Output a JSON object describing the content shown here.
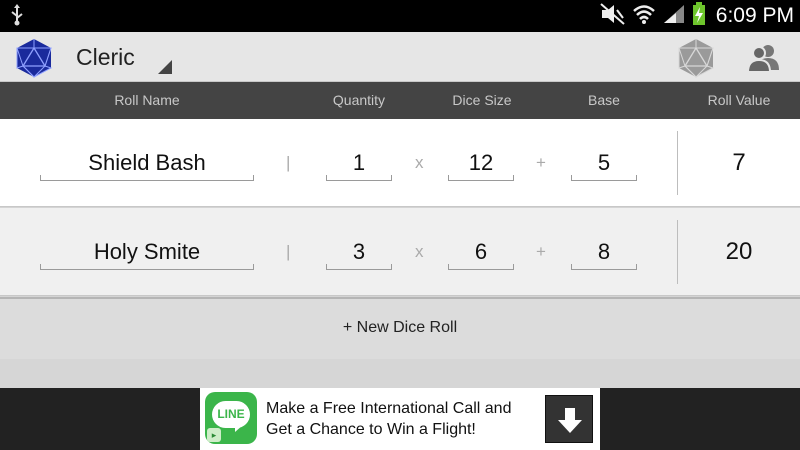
{
  "status_bar": {
    "time": "6:09 PM",
    "icons": [
      "usb-icon",
      "mute-icon",
      "wifi-icon",
      "signal-icon",
      "battery-charging-icon"
    ]
  },
  "action_bar": {
    "character": "Cleric",
    "icons": [
      "app-d20-icon",
      "dice-roll-icon",
      "party-icon"
    ]
  },
  "columns": {
    "roll_name": "Roll Name",
    "quantity": "Quantity",
    "dice_size": "Dice Size",
    "base": "Base",
    "roll_value": "Roll Value"
  },
  "operators": {
    "separator": "|",
    "times": "x",
    "plus": "+"
  },
  "rolls": [
    {
      "name": "Shield Bash",
      "quantity": "1",
      "dice_size": "12",
      "base": "5",
      "value": "7"
    },
    {
      "name": "Holy Smite",
      "quantity": "3",
      "dice_size": "6",
      "base": "8",
      "value": "20"
    }
  ],
  "new_roll_label": "+ New Dice Roll",
  "ad": {
    "logo_text": "LINE",
    "line1": "Make a Free International Call and",
    "line2": "Get a Chance to Win a Flight!",
    "icons": [
      "line-logo-icon",
      "download-arrow-icon"
    ]
  },
  "colors": {
    "status_bar": "#000000",
    "action_bar": "#e6e6e6",
    "header": "#444444",
    "header_text": "#c8c8c8",
    "app_icon": "#1a2a9c",
    "line_green": "#3bb54a",
    "battery": "#6ec52c"
  }
}
